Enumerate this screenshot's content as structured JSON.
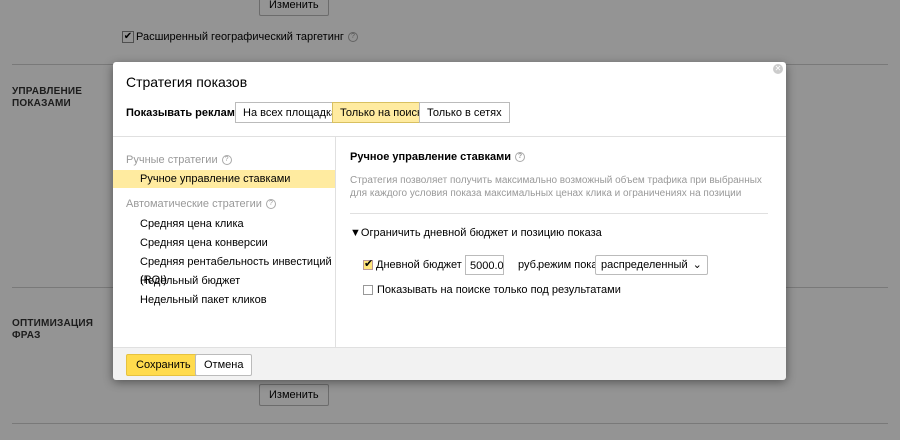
{
  "background": {
    "top_button": "Изменить",
    "geo_checkbox_label": "Расширенный географический таргетинг",
    "geo_checked": true,
    "section_impressions": [
      "УПРАВЛЕНИЕ",
      "ПОКАЗАМИ"
    ],
    "section_optimization": [
      "ОПТИМИЗАЦИЯ",
      "ФРАЗ"
    ],
    "bottom_button": "Изменить"
  },
  "modal": {
    "title": "Стратегия показов",
    "close_icon": "close-icon",
    "show_ads_label": "Показывать рекламу:",
    "placement_tabs": [
      {
        "label": "На всех площадках",
        "active": false
      },
      {
        "label": "Только на поиске",
        "active": true
      },
      {
        "label": "Только в сетях",
        "active": false
      }
    ],
    "manual_group": {
      "title": "Ручные стратегии",
      "items": [
        {
          "label": "Ручное управление ставками",
          "selected": true
        }
      ]
    },
    "auto_group": {
      "title": "Автоматические стратегии",
      "items": [
        {
          "label": "Средняя цена клика"
        },
        {
          "label": "Средняя цена конверсии"
        },
        {
          "label": "Средняя рентабельность инвестиций (ROI)"
        },
        {
          "label": "Недельный бюджет"
        },
        {
          "label": "Недельный пакет кликов"
        }
      ]
    },
    "detail": {
      "title": "Ручное управление ставками",
      "description": "Стратегия позволяет получить максимально возможный объем трафика при выбранных для каждого условия показа максимальных ценах клика и ограничениях на позиции",
      "limit_toggle": "▼Ограничить дневной бюджет и позицию показа",
      "daily_budget_label": "Дневной бюджет",
      "daily_budget_checked": true,
      "daily_budget_value": "5000.0",
      "currency_label": "руб.",
      "mode_label": "режим показа",
      "mode_value": "распределенный",
      "search_below_label": "Показывать на поиске только под результатами",
      "search_below_checked": false
    },
    "footer": {
      "save": "Сохранить",
      "cancel": "Отмена"
    }
  }
}
